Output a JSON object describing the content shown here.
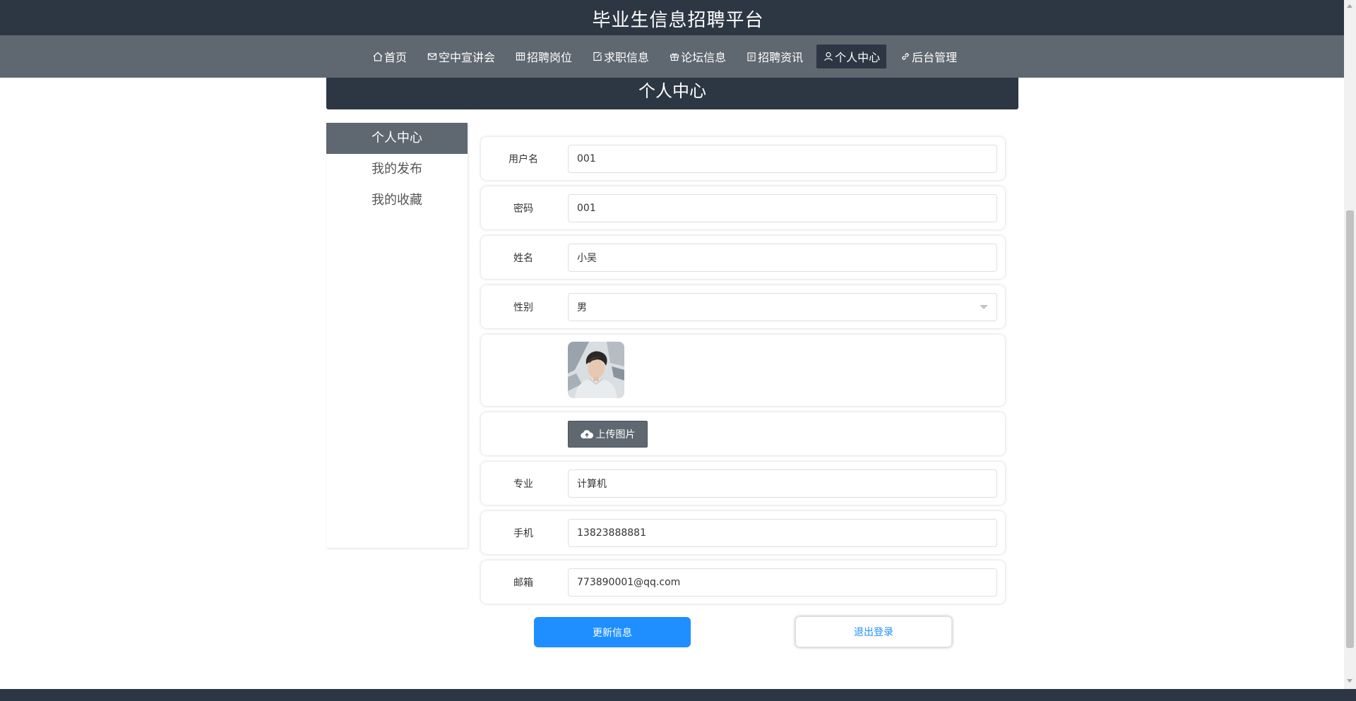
{
  "site": {
    "title": "毕业生信息招聘平台"
  },
  "nav": {
    "items": [
      {
        "label": "首页",
        "icon": "home-icon"
      },
      {
        "label": "空中宣讲会",
        "icon": "mail-icon"
      },
      {
        "label": "招聘岗位",
        "icon": "grid-icon"
      },
      {
        "label": "求职信息",
        "icon": "edit-icon"
      },
      {
        "label": "论坛信息",
        "icon": "gift-icon"
      },
      {
        "label": "招聘资讯",
        "icon": "clipboard-icon"
      },
      {
        "label": "个人中心",
        "icon": "user-icon",
        "active": true
      },
      {
        "label": "后台管理",
        "icon": "link-icon"
      }
    ]
  },
  "banner": {
    "title": "个人中心"
  },
  "sidebar": {
    "items": [
      {
        "label": "个人中心",
        "active": true
      },
      {
        "label": "我的发布"
      },
      {
        "label": "我的收藏"
      }
    ]
  },
  "form": {
    "username": {
      "label": "用户名",
      "value": "001"
    },
    "password": {
      "label": "密码",
      "value": "001"
    },
    "name": {
      "label": "姓名",
      "value": "小吴"
    },
    "gender": {
      "label": "性别",
      "value": "男"
    },
    "upload": {
      "label": "上传图片"
    },
    "major": {
      "label": "专业",
      "value": "计算机"
    },
    "phone": {
      "label": "手机",
      "value": "13823888881"
    },
    "email": {
      "label": "邮箱",
      "value": "773890001@qq.com"
    }
  },
  "actions": {
    "update_label": "更新信息",
    "logout_label": "退出登录"
  },
  "colors": {
    "header": "#2d3744",
    "nav": "#5f6770",
    "primary": "#1f8fff"
  }
}
